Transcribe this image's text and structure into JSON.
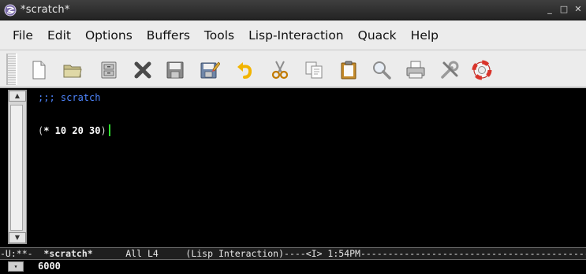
{
  "window": {
    "title": "*scratch*",
    "controls": {
      "minimize": "_",
      "maximize": "□",
      "close": "✕"
    }
  },
  "menu": [
    "File",
    "Edit",
    "Options",
    "Buffers",
    "Tools",
    "Lisp-Interaction",
    "Quack",
    "Help"
  ],
  "toolbar": [
    {
      "name": "new-file-icon"
    },
    {
      "name": "open-folder-icon"
    },
    {
      "name": "dired-cabinet-icon"
    },
    {
      "name": "close-buffer-icon"
    },
    {
      "name": "save-icon"
    },
    {
      "name": "save-as-icon"
    },
    {
      "name": "undo-icon"
    },
    {
      "name": "cut-icon"
    },
    {
      "name": "copy-icon"
    },
    {
      "name": "paste-icon"
    },
    {
      "name": "search-icon"
    },
    {
      "name": "print-icon"
    },
    {
      "name": "customize-icon"
    },
    {
      "name": "help-lifebuoy-icon"
    }
  ],
  "editor": {
    "lines": [
      ";;; scratch",
      "(* 10 20 30)"
    ],
    "code_open": "(",
    "code_body": "* 10 20 30",
    "code_close": ")"
  },
  "modeline": {
    "status": "-U:**-  ",
    "buffer": "*scratch*",
    "position": "      All L4     ",
    "mode": "(Lisp Interaction)----<I> 1:54PM--------------------------------------------"
  },
  "echo": {
    "text": "6000"
  },
  "colors": {
    "comment": "#4f86ff",
    "cursor": "#2fe02f",
    "background": "#000000"
  }
}
